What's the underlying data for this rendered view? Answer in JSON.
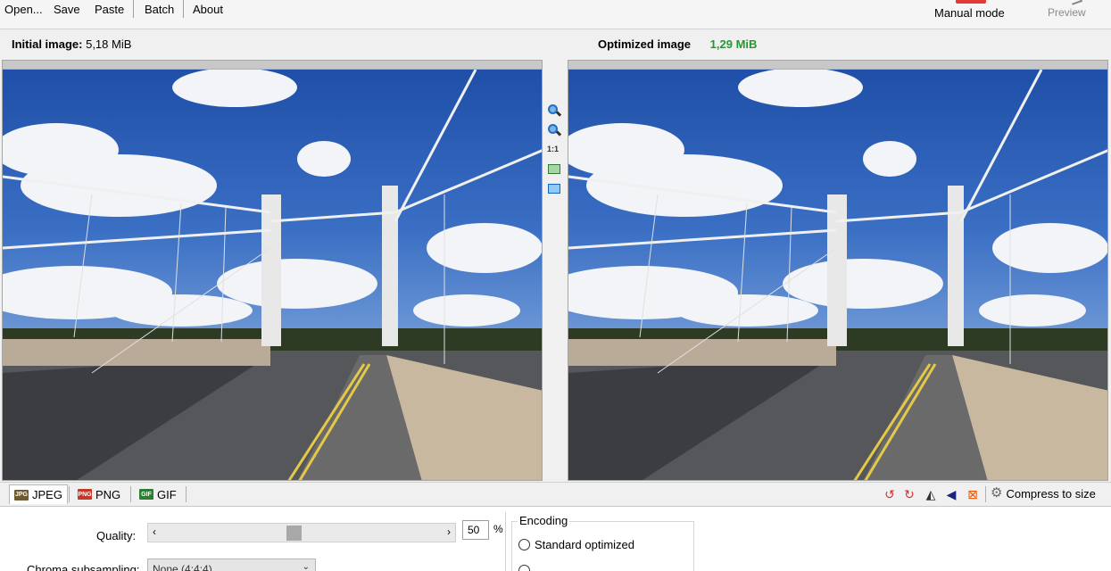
{
  "menu": {
    "open": "Open...",
    "save": "Save",
    "paste": "Paste",
    "batch": "Batch",
    "about": "About",
    "manual_mode": "Manual mode",
    "preview": "Preview"
  },
  "info": {
    "initial_label": "Initial image:",
    "initial_size": "5,18 MiB",
    "optimized_label": "Optimized image",
    "optimized_size": "1,29 MiB"
  },
  "zoom_tools": {
    "zoom_in": "zoom-in-icon",
    "zoom_out": "zoom-out-icon",
    "actual_size": "1:1",
    "fit": "fit-window-icon",
    "compare": "compare-icon"
  },
  "tabs": [
    {
      "label": "JPEG",
      "icon": "jpeg-icon",
      "active": true
    },
    {
      "label": "PNG",
      "icon": "png-icon",
      "active": false
    },
    {
      "label": "GIF",
      "icon": "gif-icon",
      "active": false
    }
  ],
  "tab_icon_text": {
    "jpeg": "JPG",
    "png": "PNG",
    "gif": "GIF"
  },
  "tools": {
    "rotate_left": "rotate-left-icon",
    "rotate_right": "rotate-right-icon",
    "flip_horizontal": "flip-horizontal-icon",
    "flip_vertical": "flip-vertical-icon",
    "crop": "crop-icon",
    "compress_label": "Compress to size"
  },
  "settings": {
    "quality_label": "Quality:",
    "quality_value": "50",
    "quality_level": 0.5,
    "percent": "%",
    "chroma_label": "Chroma subsampling:",
    "chroma_value": "None (4:4:4)",
    "encoding_legend": "Encoding",
    "encoding_options": [
      "Standard optimized"
    ]
  },
  "colors": {
    "optimized_size": "#1e9b2f",
    "sky": "#2f5fb5",
    "manual_mode_accent": "#e53935"
  }
}
